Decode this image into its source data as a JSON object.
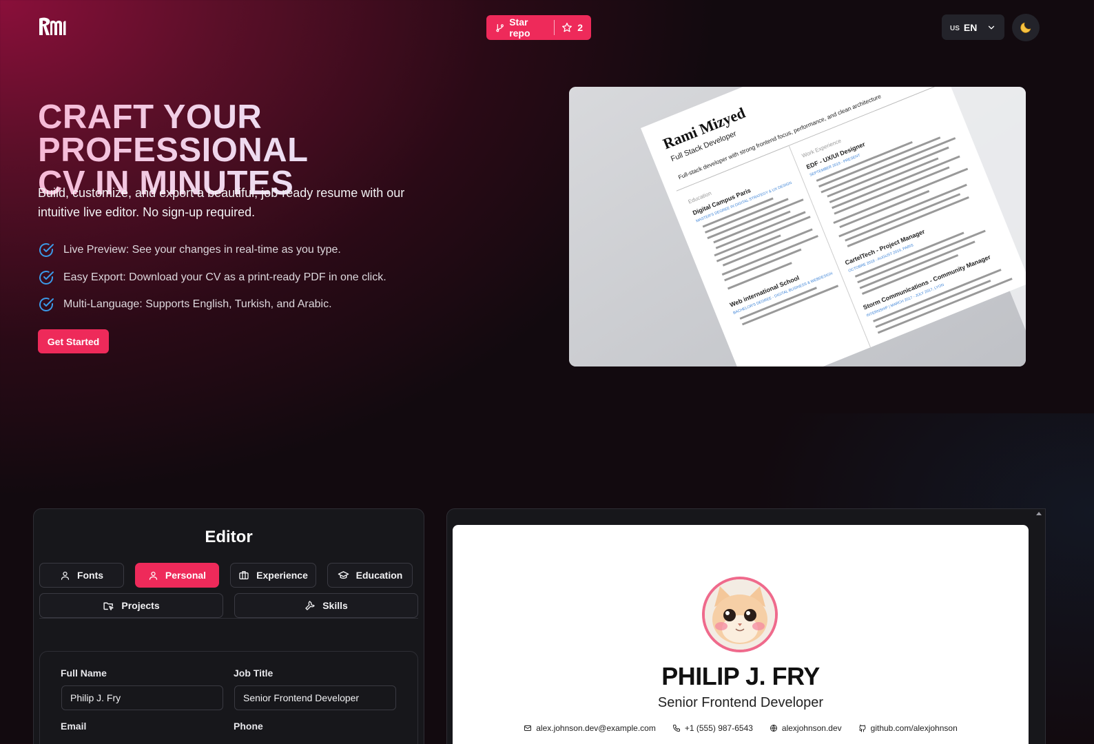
{
  "header": {
    "star_label": "Star repo",
    "star_count": "2",
    "lang_flag": "US",
    "lang_code": "EN"
  },
  "hero": {
    "title_line1": "CRAFT YOUR PROFESSIONAL",
    "title_line2": "CV IN MINUTES",
    "subtitle": "Build, customize, and export a beautiful, job-ready resume with our intuitive live editor. No sign-up required.",
    "features": [
      "Live Preview: See your changes in real-time as you type.",
      "Easy Export: Download your CV as a print-ready PDF in one click.",
      "Multi-Language: Supports English, Turkish, and Arabic."
    ],
    "cta": "Get Started"
  },
  "sample_cv": {
    "name": "Rami Mizyed",
    "role": "Full Stack Developer",
    "summary": "Full-stack developer with strong frontend focus, performance, and clean architecture",
    "education_heading": "Education",
    "work_heading": "Work Experience",
    "edu1": "Digital Campus Paris",
    "edu1_degree": "MASTER'S DEGREE IN DIGITAL STRATEGY & UX DESIGN",
    "edu2": "Web international School",
    "edu2_degree": "BACHELOR'S DEGREE - DIGITAL BUSINESS & WEBDESIGN",
    "job1": "EDF - UX/UI Designer",
    "job1_dates": "SEPTEMBER 2019 - PRESENT",
    "job2": "CartelTech - Project Manager",
    "job2_dates": "OCTOBRE 2018 - AUGUST 2019, PARIS",
    "job3": "Storm Communications - Community Manager",
    "job3_dates": "INTERNSHIP | MARCH 2017 - JULY 2017, LYON"
  },
  "editor": {
    "title": "Editor",
    "tabs": [
      "Fonts",
      "Personal",
      "Experience",
      "Education",
      "Projects",
      "Skills"
    ],
    "active_tab": "Personal",
    "fields": {
      "full_name_label": "Full Name",
      "full_name_value": "Philip J. Fry",
      "job_title_label": "Job Title",
      "job_title_value": "Senior Frontend Developer",
      "email_label": "Email",
      "phone_label": "Phone"
    }
  },
  "preview": {
    "name": "PHILIP J. FRY",
    "job_title": "Senior Frontend Developer",
    "email": "alex.johnson.dev@example.com",
    "phone": "+1 (555) 987-6543",
    "website": "alexjohnson.dev",
    "github": "github.com/alexjohnson"
  },
  "colors": {
    "accent": "#ee2a5a",
    "check": "#3b9ae8",
    "avatar_ring": "#ef6a8c"
  }
}
